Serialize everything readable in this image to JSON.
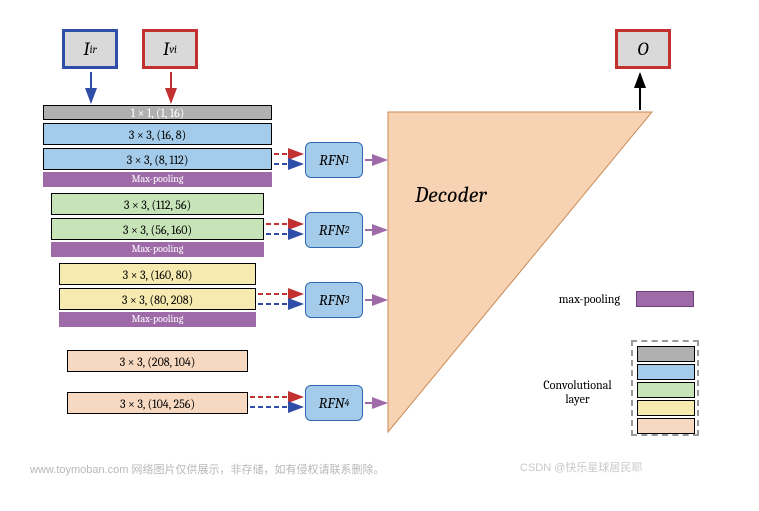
{
  "inputs": {
    "ir": "I",
    "ir_sub": "ir",
    "vi": "I",
    "vi_sub": "vi"
  },
  "output": "O",
  "stages": {
    "s0": "1 × 1, (1, 16)",
    "s1a": "3 × 3, (16, 8)",
    "s1b": "3 × 3, (8, 112)",
    "pool": "Max-pooling",
    "s2a": "3 × 3, (112, 56)",
    "s2b": "3 × 3, (56, 160)",
    "s3a": "3 × 3, (160, 80)",
    "s3b": "3 × 3, (80, 208)",
    "s4a": "3 × 3, (208, 104)",
    "s4b": "3 × 3, (104, 256)"
  },
  "rfn": {
    "r1": "RFN",
    "r1s": "1",
    "r2": "RFN",
    "r2s": "2",
    "r3": "RFN",
    "r3s": "3",
    "r4": "RFN",
    "r4s": "4"
  },
  "decoder": "Decoder",
  "legend": {
    "maxpool": "max-pooling",
    "convlayer": "Convolutional\nlayer"
  },
  "footer_left": "www.toymoban.com  网络图片仅供展示，非存储，如有侵权请联系删除。",
  "footer_right": "CSDN @快乐星球居民耶",
  "chart_data": {
    "type": "table",
    "title": "RFN-Nest encoder-decoder architecture",
    "inputs": [
      "I_ir",
      "I_vi"
    ],
    "encoder_layers": [
      {
        "stage": 0,
        "kernel": "1x1",
        "in_channels": 1,
        "out_channels": 16,
        "color": "grey"
      },
      {
        "stage": 1,
        "kernel": "3x3",
        "in_channels": 16,
        "out_channels": 8,
        "color": "blue"
      },
      {
        "stage": 1,
        "kernel": "3x3",
        "in_channels": 8,
        "out_channels": 112,
        "color": "blue",
        "followed_by": "max-pooling"
      },
      {
        "stage": 2,
        "kernel": "3x3",
        "in_channels": 112,
        "out_channels": 56,
        "color": "green"
      },
      {
        "stage": 2,
        "kernel": "3x3",
        "in_channels": 56,
        "out_channels": 160,
        "color": "green",
        "followed_by": "max-pooling"
      },
      {
        "stage": 3,
        "kernel": "3x3",
        "in_channels": 160,
        "out_channels": 80,
        "color": "yellow"
      },
      {
        "stage": 3,
        "kernel": "3x3",
        "in_channels": 80,
        "out_channels": 208,
        "color": "yellow",
        "followed_by": "max-pooling"
      },
      {
        "stage": 4,
        "kernel": "3x3",
        "in_channels": 208,
        "out_channels": 104,
        "color": "peach"
      },
      {
        "stage": 4,
        "kernel": "3x3",
        "in_channels": 104,
        "out_channels": 256,
        "color": "peach"
      }
    ],
    "fusion_blocks": [
      "RFN_1",
      "RFN_2",
      "RFN_3",
      "RFN_4"
    ],
    "decoder": "Decoder",
    "output": "O",
    "legend": {
      "purple": "max-pooling",
      "swatches": [
        "grey",
        "blue",
        "green",
        "yellow",
        "peach"
      ],
      "swatch_meaning": "Convolutional layer"
    }
  }
}
